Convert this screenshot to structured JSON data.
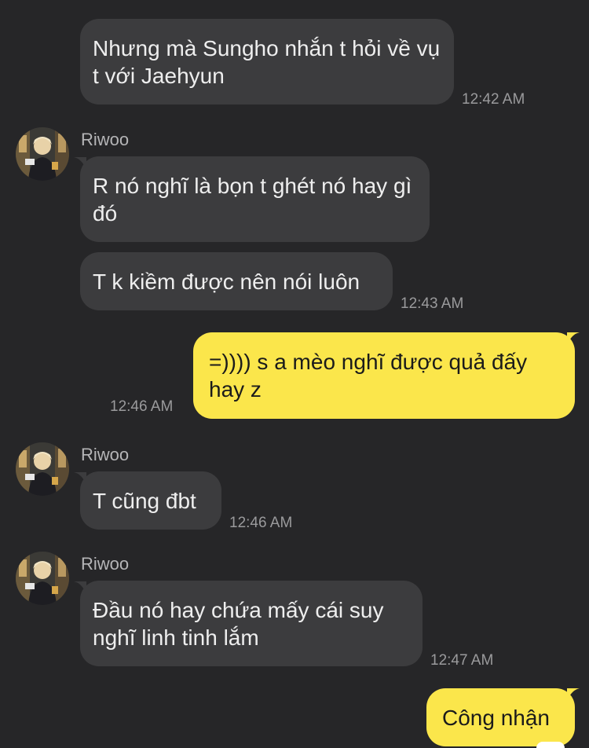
{
  "colors": {
    "background": "#262628",
    "incoming_bubble": "#3c3c3e",
    "outgoing_bubble": "#fbe64b",
    "timestamp": "#9a9a9c"
  },
  "messages": [
    {
      "text": "Nhưng mà Sungho nhắn t hỏi về vụ t với Jaehyun",
      "time": "12:42 AM"
    },
    {
      "sender": "Riwoo",
      "avatar": "profile-photo"
    },
    {
      "text": "R nó nghĩ là bọn t ghét nó hay gì đó"
    },
    {
      "text": "T k kiềm được nên nói luôn",
      "time": "12:43 AM"
    },
    {
      "text": "=)))) s a mèo nghĩ được quả đấy hay z",
      "time": "12:46 AM"
    },
    {
      "sender": "Riwoo",
      "avatar": "profile-photo"
    },
    {
      "text": "T cũng đbt",
      "time": "12:46 AM"
    },
    {
      "sender": "Riwoo",
      "avatar": "profile-photo"
    },
    {
      "text": "Đầu nó hay chứa mấy cái suy nghĩ linh tinh lắm",
      "time": "12:47 AM"
    },
    {
      "text": "Công nhận"
    }
  ]
}
